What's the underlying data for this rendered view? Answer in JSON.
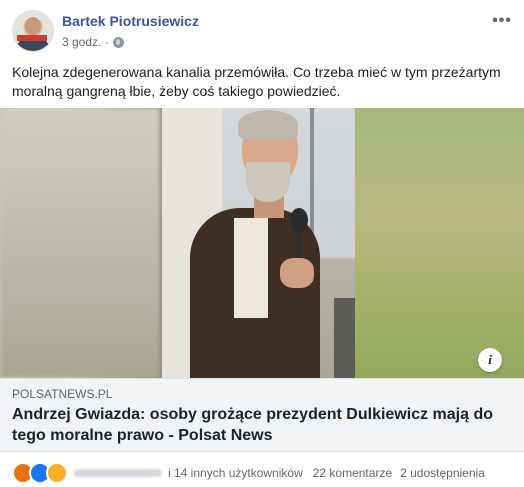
{
  "author": {
    "name": "Bartek Piotrusiewicz",
    "time": "3 godz.",
    "separator": "·"
  },
  "post": {
    "text": "Kolejna zdegenerowana kanalia przemówiła. Co trzeba mieć w tym przeżartym moralną gangreną łbie, żeby coś takiego powiedzieć."
  },
  "link_preview": {
    "domain": "POLSATNEWS.PL",
    "title": "Andrzej Gwiazda: osoby grożące prezydent Dulkiewicz mają do tego moralne prawo - Polsat News",
    "info_label": "i"
  },
  "footer": {
    "reactions": [
      "angry",
      "like",
      "sad"
    ],
    "others": "i 14 innych użytkowników",
    "comments": "22 komentarze",
    "shares": "2 udostępnienia"
  },
  "menu_label": "•••"
}
